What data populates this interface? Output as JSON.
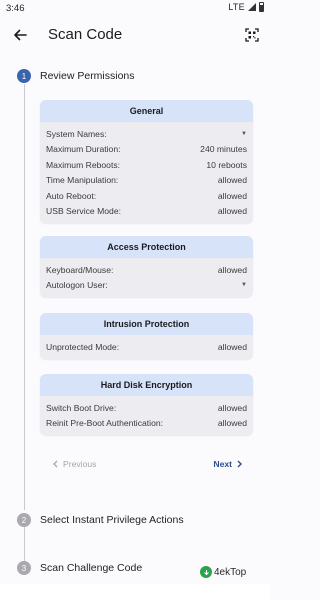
{
  "status_bar": {
    "time": "3:46",
    "network": "LTE"
  },
  "app_bar": {
    "title": "Scan Code"
  },
  "steps": [
    {
      "number": "1",
      "title": "Review Permissions"
    },
    {
      "number": "2",
      "title": "Select Instant Privilege Actions"
    },
    {
      "number": "3",
      "title": "Scan Challenge Code"
    }
  ],
  "cards": {
    "general": {
      "title": "General",
      "rows": [
        {
          "label": "System Names:",
          "value": ""
        },
        {
          "label": "Maximum Duration:",
          "value": "240 minutes"
        },
        {
          "label": "Maximum Reboots:",
          "value": "10 reboots"
        },
        {
          "label": "Time Manipulation:",
          "value": "allowed"
        },
        {
          "label": "Auto Reboot:",
          "value": "allowed"
        },
        {
          "label": "USB Service Mode:",
          "value": "allowed"
        }
      ]
    },
    "access": {
      "title": "Access Protection",
      "rows": [
        {
          "label": "Keyboard/Mouse:",
          "value": "allowed"
        },
        {
          "label": "Autologon User:",
          "value": ""
        }
      ]
    },
    "intrusion": {
      "title": "Intrusion Protection",
      "rows": [
        {
          "label": "Unprotected Mode:",
          "value": "allowed"
        }
      ]
    },
    "disk": {
      "title": "Hard Disk Encryption",
      "rows": [
        {
          "label": "Switch Boot Drive:",
          "value": "allowed"
        },
        {
          "label": "Reinit Pre-Boot Authentication:",
          "value": "allowed"
        }
      ]
    }
  },
  "pager": {
    "previous_label": "Previous",
    "next_label": "Next"
  },
  "watermark": {
    "text": "4ekTop"
  },
  "colors": {
    "accent": "#3a63b0",
    "card_header": "#d7e3f8",
    "card_bg": "#ececf1"
  }
}
